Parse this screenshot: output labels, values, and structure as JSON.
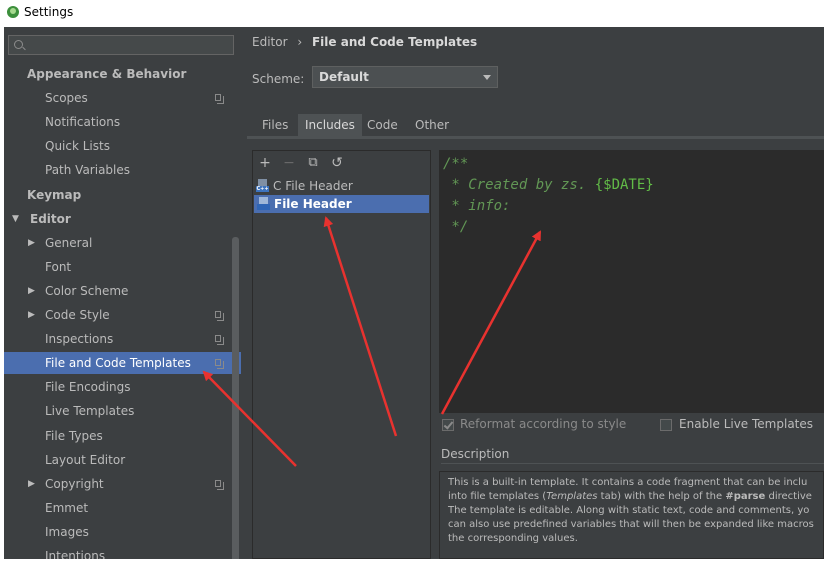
{
  "window": {
    "title": "Settings"
  },
  "sidebar": {
    "search_placeholder": "",
    "items": [
      {
        "label": "Appearance & Behavior",
        "bold": true,
        "level": 0
      },
      {
        "label": "Scopes",
        "level": 1,
        "copy": true
      },
      {
        "label": "Notifications",
        "level": 1
      },
      {
        "label": "Quick Lists",
        "level": 1
      },
      {
        "label": "Path Variables",
        "level": 1
      },
      {
        "label": "Keymap",
        "bold": true,
        "level": 0
      },
      {
        "label": "Editor",
        "bold": true,
        "level": 0,
        "expanded": true
      },
      {
        "label": "General",
        "level": 1,
        "collapsed": true
      },
      {
        "label": "Font",
        "level": 1
      },
      {
        "label": "Color Scheme",
        "level": 1,
        "collapsed": true
      },
      {
        "label": "Code Style",
        "level": 1,
        "collapsed": true,
        "copy": true
      },
      {
        "label": "Inspections",
        "level": 1,
        "copy": true
      },
      {
        "label": "File and Code Templates",
        "level": 1,
        "copy": true,
        "selected": true
      },
      {
        "label": "File Encodings",
        "level": 1
      },
      {
        "label": "Live Templates",
        "level": 1
      },
      {
        "label": "File Types",
        "level": 1
      },
      {
        "label": "Layout Editor",
        "level": 1
      },
      {
        "label": "Copyright",
        "level": 1,
        "collapsed": true,
        "copy": true
      },
      {
        "label": "Emmet",
        "level": 1
      },
      {
        "label": "Images",
        "level": 1
      },
      {
        "label": "Intentions",
        "level": 1
      }
    ]
  },
  "main": {
    "breadcrumb": {
      "parent": "Editor",
      "separator": "›",
      "current": "File and Code Templates"
    },
    "scheme": {
      "label": "Scheme:",
      "value": "Default"
    },
    "tabs": [
      {
        "label": "Files",
        "active": false
      },
      {
        "label": "Includes",
        "active": true
      },
      {
        "label": "Code",
        "active": false
      },
      {
        "label": "Other",
        "active": false
      }
    ],
    "toolbar": {
      "add": "+",
      "remove": "−",
      "copy": "⧉",
      "reset": "↺"
    },
    "templates": [
      {
        "label": "C File Header",
        "icon_text": "C++",
        "selected": false
      },
      {
        "label": "File Header",
        "icon_text": "",
        "selected": true
      }
    ],
    "editor": {
      "lines": [
        "/**",
        " * Created by zs. ",
        " * info:",
        " */"
      ],
      "variable": "{$DATE}"
    },
    "options": {
      "reformat": {
        "label": "Reformat according to style",
        "checked": true,
        "enabled": false
      },
      "live_templates": {
        "label": "Enable Live Templates",
        "checked": false
      }
    },
    "description": {
      "title": "Description",
      "lines": [
        {
          "pre": "This is a built-in template. It contains a code fragment that can be inclu",
          "it": "",
          "mid": "",
          "b": "",
          "post": ""
        },
        {
          "pre": "into file templates (",
          "it": "Templates",
          "mid": " tab) with the help of the ",
          "b": "#parse",
          "post": " directive"
        },
        {
          "pre": "The template is editable. Along with static text, code and comments, yo",
          "it": "",
          "mid": "",
          "b": "",
          "post": ""
        },
        {
          "pre": "can also use predefined variables that will then be expanded like macros",
          "it": "",
          "mid": "",
          "b": "",
          "post": ""
        },
        {
          "pre": "the corresponding values.",
          "it": "",
          "mid": "",
          "b": "",
          "post": ""
        }
      ]
    }
  },
  "colors": {
    "panel": "#3c3f41",
    "editor_bg": "#2b2b2b",
    "selection": "#4b6eaf",
    "comment": "#629755",
    "annotation_arrow": "#e8322f"
  }
}
